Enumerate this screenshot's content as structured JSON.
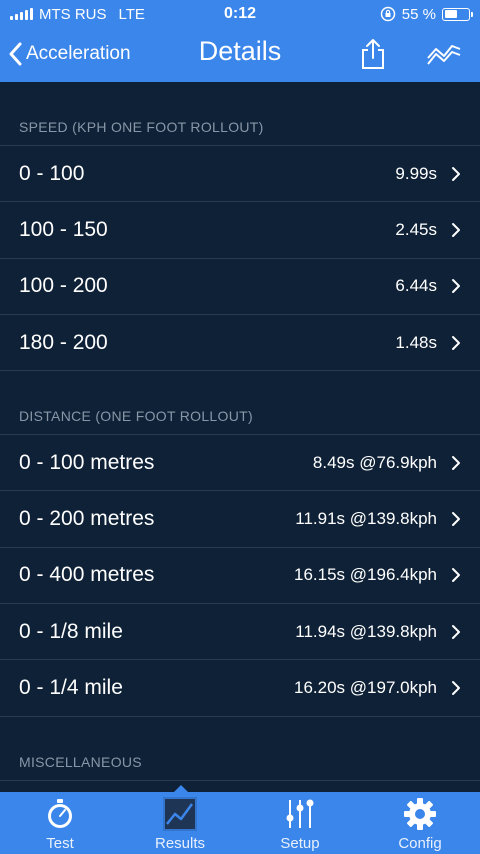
{
  "status_bar": {
    "carrier": "MTS RUS",
    "network": "LTE",
    "time": "0:12",
    "battery_percent": "55 %",
    "battery_level": 0.55
  },
  "nav": {
    "back_label": "Acceleration",
    "title": "Details"
  },
  "sections": {
    "speed": {
      "header": "SPEED (KPH ONE FOOT ROLLOUT)",
      "rows": [
        {
          "label": "0 - 100",
          "value": "9.99s"
        },
        {
          "label": "100 - 150",
          "value": "2.45s"
        },
        {
          "label": "100 - 200",
          "value": "6.44s"
        },
        {
          "label": "180 - 200",
          "value": "1.48s"
        }
      ]
    },
    "distance": {
      "header": "DISTANCE (ONE FOOT ROLLOUT)",
      "rows": [
        {
          "label": "0 - 100 metres",
          "value": "8.49s @76.9kph"
        },
        {
          "label": "0 - 200 metres",
          "value": "11.91s @139.8kph"
        },
        {
          "label": "0 - 400 metres",
          "value": "16.15s @196.4kph"
        },
        {
          "label": "0 - 1/8 mile",
          "value": "11.94s @139.8kph"
        },
        {
          "label": "0 - 1/4 mile",
          "value": "16.20s @197.0kph"
        }
      ]
    },
    "misc": {
      "header": "MISCELLANEOUS"
    }
  },
  "tabs": [
    {
      "label": "Test",
      "icon": "stopwatch-icon"
    },
    {
      "label": "Results",
      "icon": "chart-icon",
      "active": true
    },
    {
      "label": "Setup",
      "icon": "sliders-icon"
    },
    {
      "label": "Config",
      "icon": "gear-icon"
    }
  ],
  "colors": {
    "accent": "#3b86ea",
    "background": "#0f2136",
    "header_text": "#8896a8"
  }
}
